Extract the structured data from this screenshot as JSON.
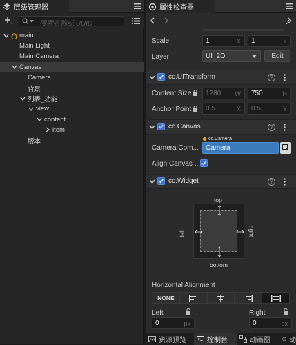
{
  "hierarchy": {
    "tab_title": "层级管理器",
    "search_placeholder": "搜索名称或 UUID",
    "tree": [
      {
        "label": "main",
        "depth": 0,
        "expanded": true,
        "selected": false
      },
      {
        "label": "Main Light",
        "depth": 1,
        "expanded": null,
        "selected": false
      },
      {
        "label": "Main Camera",
        "depth": 1,
        "expanded": null,
        "selected": false
      },
      {
        "label": "Canvas",
        "depth": 1,
        "expanded": true,
        "selected": true
      },
      {
        "label": "Camera",
        "depth": 2,
        "expanded": null,
        "selected": false
      },
      {
        "label": "背景",
        "depth": 2,
        "expanded": null,
        "selected": false
      },
      {
        "label": "列表_功能",
        "depth": 2,
        "expanded": true,
        "selected": false
      },
      {
        "label": "view",
        "depth": 3,
        "expanded": true,
        "selected": false
      },
      {
        "label": "content",
        "depth": 4,
        "expanded": true,
        "selected": false
      },
      {
        "label": "item",
        "depth": 5,
        "expanded": false,
        "selected": false
      },
      {
        "label": "版本",
        "depth": 2,
        "expanded": null,
        "selected": false
      }
    ]
  },
  "inspector": {
    "tab_title": "属性检查器",
    "scale": {
      "label": "Scale",
      "x": "1",
      "x_axis": "X",
      "y": "1",
      "y_axis": "Y"
    },
    "layer": {
      "label": "Layer",
      "value": "UI_2D",
      "edit_label": "Edit"
    },
    "ui_transform": {
      "title": "cc.UITransform",
      "content_size": {
        "label": "Content Size",
        "w": "1280",
        "w_axis": "W",
        "h": "750",
        "h_axis": "H"
      },
      "anchor_point": {
        "label": "Anchor Point",
        "x": "0.5",
        "x_axis": "X",
        "y": "0.5",
        "y_axis": "Y"
      }
    },
    "canvas": {
      "title": "cc.Canvas",
      "camera_component": {
        "label": "Camera Com...",
        "tag": "cc.Camera",
        "value": "Camera"
      },
      "align_canvas": {
        "label": "Align Canvas ...",
        "checked": true
      }
    },
    "widget": {
      "title": "cc.Widget",
      "diagram": {
        "top": "top",
        "bottom": "bottom",
        "left": "left",
        "right": "right"
      },
      "horizontal_alignment": {
        "label": "Horizontal Alignment",
        "none_label": "NONE"
      },
      "left": {
        "label": "Left",
        "value": "0",
        "unit": "px"
      },
      "right": {
        "label": "Right",
        "value": "0",
        "unit": "px"
      }
    }
  },
  "bottom_tabs": [
    {
      "label": "资源预览",
      "active": false
    },
    {
      "label": "控制台",
      "active": true
    },
    {
      "label": "动画图",
      "active": false
    },
    {
      "label": "动",
      "active": false
    }
  ],
  "colors": {
    "accent": "#3b6fc8",
    "camera_field": "#3b7bbd",
    "selection": "#3a3a3a"
  }
}
